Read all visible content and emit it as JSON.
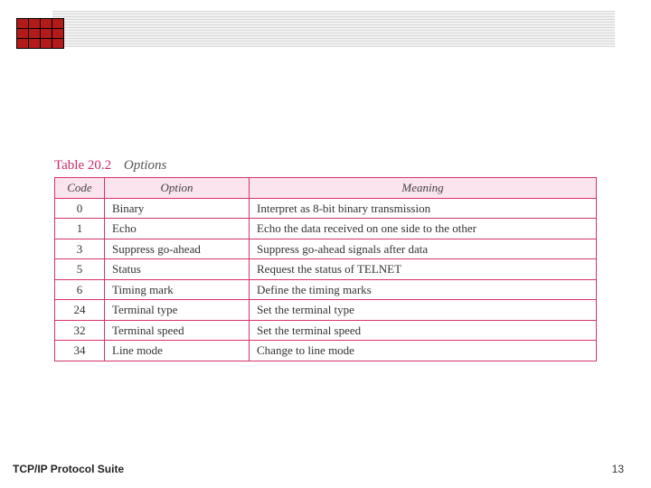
{
  "caption": {
    "number": "Table 20.2",
    "title": "Options"
  },
  "headers": {
    "code": "Code",
    "option": "Option",
    "meaning": "Meaning"
  },
  "rows": [
    {
      "code": "0",
      "option": "Binary",
      "meaning": "Interpret as 8-bit binary transmission"
    },
    {
      "code": "1",
      "option": "Echo",
      "meaning": "Echo the data received on one side to the other"
    },
    {
      "code": "3",
      "option": "Suppress go-ahead",
      "meaning": "Suppress go-ahead signals after data"
    },
    {
      "code": "5",
      "option": "Status",
      "meaning": "Request the status of TELNET"
    },
    {
      "code": "6",
      "option": "Timing mark",
      "meaning": "Define the timing marks"
    },
    {
      "code": "24",
      "option": "Terminal type",
      "meaning": "Set the terminal type"
    },
    {
      "code": "32",
      "option": "Terminal speed",
      "meaning": "Set the terminal speed"
    },
    {
      "code": "34",
      "option": "Line mode",
      "meaning": "Change to line mode"
    }
  ],
  "footer": {
    "label": "TCP/IP Protocol Suite",
    "page": "13"
  },
  "chart_data": {
    "type": "table",
    "title": "Table 20.2 Options",
    "columns": [
      "Code",
      "Option",
      "Meaning"
    ],
    "rows": [
      [
        "0",
        "Binary",
        "Interpret as 8-bit binary transmission"
      ],
      [
        "1",
        "Echo",
        "Echo the data received on one side to the other"
      ],
      [
        "3",
        "Suppress go-ahead",
        "Suppress go-ahead signals after data"
      ],
      [
        "5",
        "Status",
        "Request the status of TELNET"
      ],
      [
        "6",
        "Timing mark",
        "Define the timing marks"
      ],
      [
        "24",
        "Terminal type",
        "Set the terminal type"
      ],
      [
        "32",
        "Terminal speed",
        "Set the terminal speed"
      ],
      [
        "34",
        "Line mode",
        "Change to line mode"
      ]
    ]
  }
}
